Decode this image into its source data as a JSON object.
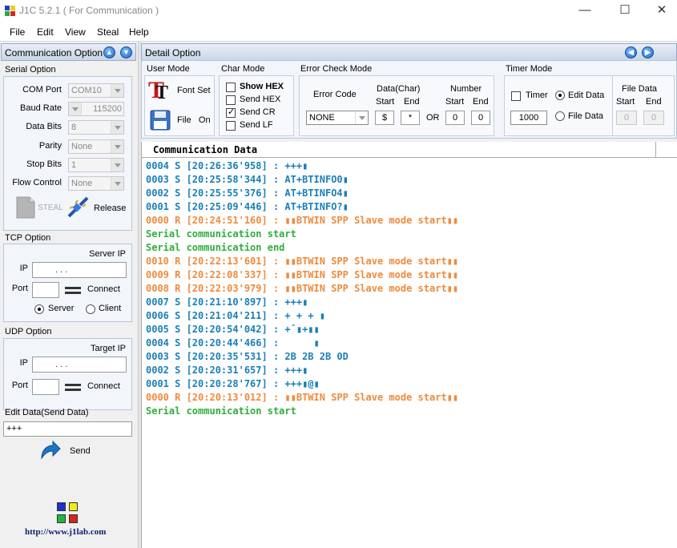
{
  "window": {
    "title": "J1C 5.2.1 ( For Communication )",
    "minimize": "—",
    "maximize": "☐",
    "close": "✕"
  },
  "menu": [
    "File",
    "Edit",
    "View",
    "Steal",
    "Help"
  ],
  "comm_panel": {
    "title": "Communication Option",
    "serial": {
      "label": "Serial Option",
      "com_port_label": "COM Port",
      "com_port": "COM10",
      "baud_label": "Baud Rate",
      "baud": "115200",
      "databits_label": "Data Bits",
      "databits": "8",
      "parity_label": "Parity",
      "parity": "None",
      "stopbits_label": "Stop Bits",
      "stopbits": "1",
      "flow_label": "Flow Control",
      "flow": "None",
      "steal": "STEAL",
      "release": "Release"
    },
    "tcp": {
      "label": "TCP Option",
      "server_ip": "Server IP",
      "ip_label": "IP",
      "ip": ".     .     .",
      "port_label": "Port",
      "connect": "Connect",
      "server": "Server",
      "client": "Client"
    },
    "udp": {
      "label": "UDP Option",
      "target_ip": "Target IP",
      "ip_label": "IP",
      "ip": ".     .     .",
      "port_label": "Port",
      "connect": "Connect"
    },
    "edit": {
      "label": "Edit Data(Send Data)",
      "value": "+++",
      "send": "Send"
    },
    "url": "http://www.j1lab.com"
  },
  "detail": {
    "title": "Detail Option",
    "user_mode": {
      "label": "User Mode",
      "font_set": "Font Set",
      "file": "File",
      "on": "On"
    },
    "char_mode": {
      "label": "Char Mode",
      "show_hex": "Show HEX",
      "send_hex": "Send HEX",
      "send_cr": "Send CR",
      "send_lf": "Send LF"
    },
    "error_check": {
      "label": "Error Check Mode",
      "error_code": "Error Code",
      "data_char": "Data(Char)",
      "number": "Number",
      "start": "Start",
      "end": "End",
      "error_value": "NONE",
      "char_start": "$",
      "char_end": "*",
      "or": "OR",
      "num_start": "0",
      "num_end": "0"
    },
    "timer": {
      "label": "Timer Mode",
      "timer": "Timer",
      "timer_value": "1000",
      "edit_data": "Edit Data",
      "file_data_opt": "File Data",
      "file_data": "File Data",
      "start": "Start",
      "end": "End",
      "fd_start": "0",
      "fd_end": "0"
    }
  },
  "comm_data": {
    "header": "Communication Data",
    "lines": [
      {
        "t": "s",
        "text": "0004 S [20:26:36'958] : +++▮"
      },
      {
        "t": "s",
        "text": "0003 S [20:25:58'344] : AT+BTINFO0▮"
      },
      {
        "t": "s",
        "text": "0002 S [20:25:55'376] : AT+BTINFO4▮"
      },
      {
        "t": "s",
        "text": "0001 S [20:25:09'446] : AT+BTINFO?▮"
      },
      {
        "t": "r",
        "text": "0000 R [20:24:51'160] : ▮▮BTWIN SPP Slave mode start▮▮"
      },
      {
        "t": "g",
        "text": "Serial communication start"
      },
      {
        "t": "g",
        "text": "Serial communication end"
      },
      {
        "t": "r",
        "text": "0010 R [20:22:13'601] : ▮▮BTWIN SPP Slave mode start▮▮"
      },
      {
        "t": "r",
        "text": "0009 R [20:22:08'337] : ▮▮BTWIN SPP Slave mode start▮▮"
      },
      {
        "t": "r",
        "text": "0008 R [20:22:03'979] : ▮▮BTWIN SPP Slave mode start▮▮"
      },
      {
        "t": "s",
        "text": "0007 S [20:21:10'897] : +++▮"
      },
      {
        "t": "s",
        "text": "0006 S [20:21:04'211] : + + + ▮"
      },
      {
        "t": "s",
        "text": "0005 S [20:20:54'042] : +¯▮+▮▮"
      },
      {
        "t": "s",
        "text": "0004 S [20:20:44'466] :      ▮"
      },
      {
        "t": "s",
        "text": "0003 S [20:20:35'531] : 2B 2B 2B 0D"
      },
      {
        "t": "s",
        "text": "0002 S [20:20:31'657] : +++▮"
      },
      {
        "t": "s",
        "text": "0001 S [20:20:28'767] : +++▮@▮"
      },
      {
        "t": "r",
        "text": "0000 R [20:20:13'012] : ▮▮BTWIN SPP Slave mode start▮▮"
      },
      {
        "t": "g",
        "text": "Serial communication start"
      }
    ]
  },
  "icons": [
    "up-arrow-icon",
    "down-arrow-icon",
    "steal-icon",
    "release-plug-icon",
    "font-set-icon",
    "floppy-icon",
    "send-arrow-icon",
    "j1lab-logo-icon"
  ]
}
